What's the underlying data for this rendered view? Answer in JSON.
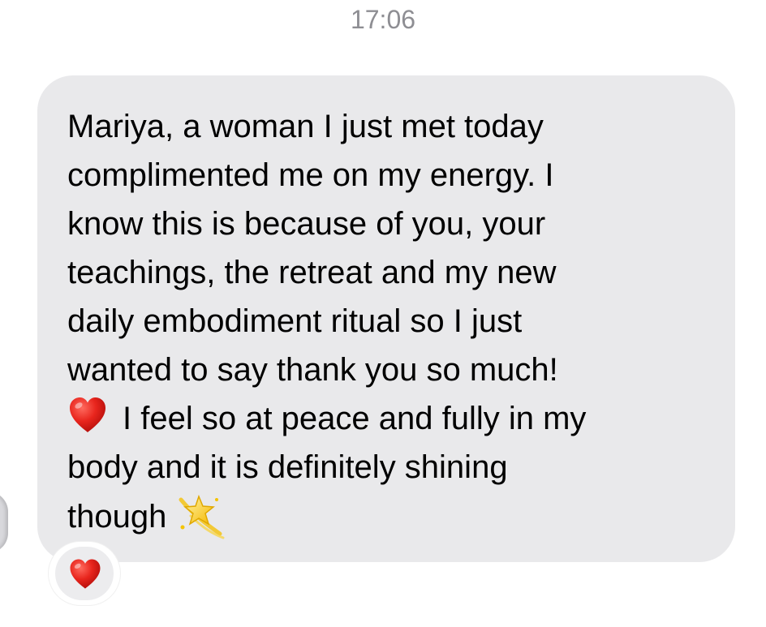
{
  "header": {
    "timestamp": "17:06"
  },
  "message": {
    "lines": [
      "Mariya, a woman I just met today",
      "complimented me on my energy. I",
      "know this is because of you, your",
      "teachings, the retreat and my new",
      "daily embodiment ritual so I just",
      "wanted to say thank you so much!",
      "I feel so at peace and fully in my",
      "body and it is definitely shining",
      "though"
    ],
    "inline_icons": [
      "red-heart-icon",
      "dizzy-star-icon"
    ]
  },
  "reaction": {
    "icon": "red-heart-icon"
  },
  "colors": {
    "bubble": "#e9e9eb",
    "timestamp": "#8e8e93",
    "heart": "#e0201b"
  }
}
